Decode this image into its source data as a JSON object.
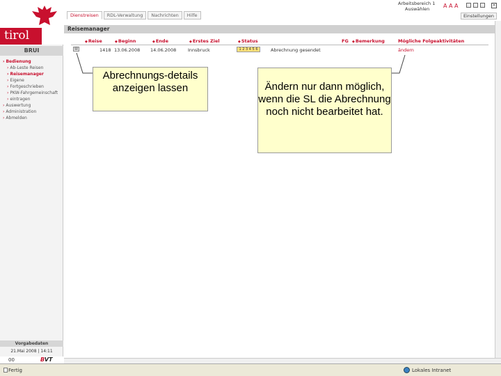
{
  "sidebar": {
    "logo_text": "tirol",
    "user": "BRUI",
    "nav": [
      {
        "label": "Bedienung",
        "active": true,
        "sub": false
      },
      {
        "label": "Ab-Leste Reisen",
        "active": false,
        "sub": true
      },
      {
        "label": "Reisemanager",
        "active": true,
        "sub": true
      },
      {
        "label": "Eigene",
        "active": false,
        "sub": true
      },
      {
        "label": "Fortgeschrieben",
        "active": false,
        "sub": true
      },
      {
        "label": "PKW-Fahrgemeinschaft",
        "active": false,
        "sub": true
      },
      {
        "label": "eintragen",
        "active": false,
        "sub": true
      },
      {
        "label": "Auswertung",
        "active": false,
        "sub": false
      },
      {
        "label": "Administration",
        "active": false,
        "sub": false
      },
      {
        "label": "Abmelden",
        "active": false,
        "sub": false
      }
    ],
    "footer_label": "Vorgabedaten",
    "footer_date": "21.Mai 2008 | 14:11",
    "footer_id": "00",
    "footer_brand_b": "B",
    "footer_brand_rest": "VT"
  },
  "header": {
    "tabs": [
      {
        "label": "Dienstreisen",
        "active": true
      },
      {
        "label": "RDL-Verwaltung",
        "active": false
      },
      {
        "label": "Nachrichten",
        "active": false
      },
      {
        "label": "Hilfe",
        "active": false
      }
    ],
    "area_title": "Arbeitsbereich 1",
    "area_select": "Auswählen",
    "font_controls": "A A A",
    "close_glyph": "×",
    "settings_label": "Einstellungen"
  },
  "content": {
    "page_title": "Reisemanager",
    "columns": [
      "Reise",
      "Beginn",
      "Ende",
      "Erstes Ziel",
      "Status",
      "FG",
      "Bemerkung",
      "Mögliche Folgeaktivitäten"
    ],
    "row": {
      "detail_glyph": "▤",
      "reise": "1418",
      "beginn": "13.06.2008",
      "ende": "14.06.2008",
      "ziel": "Innsbruck",
      "status": "1 2 3 4 5 6",
      "bemerkung": "Abrechnung gesendet",
      "aktion": "ändern"
    }
  },
  "callouts": {
    "details": "Abrechnungs-details anzeigen lassen",
    "change": "Ändern nur dann möglich, wenn die SL die Abrechnung noch nicht bearbeitet hat."
  },
  "statusbar": {
    "left": "Fertig",
    "right": "Lokales Intranet"
  },
  "colors": {
    "accent": "#c8102e",
    "callout_bg": "#ffffcc"
  }
}
